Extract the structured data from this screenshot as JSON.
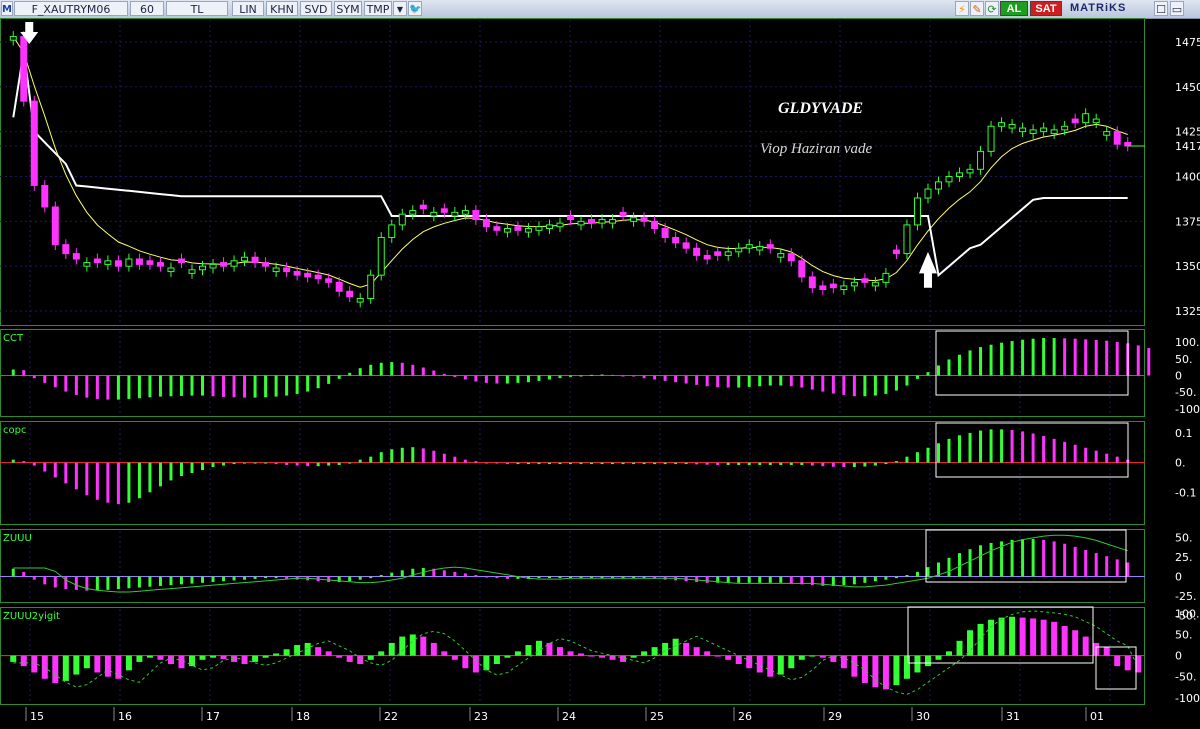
{
  "toolbar": {
    "symbol": "F_XAUTRYM06",
    "period": "60",
    "currency": "TL",
    "buttons": [
      "LIN",
      "KHN",
      "SVD",
      "SYM",
      "TMP"
    ],
    "al_label": "AL",
    "sat_label": "SAT",
    "brand": "MATRiKS",
    "icons": [
      "m-logo-icon",
      "indicator-icon",
      "dropdown-arrow-icon",
      "twitter-bird-icon",
      "lightning-icon",
      "edit-icon",
      "refresh-icon",
      "checkbox-icon",
      "window-icon"
    ]
  },
  "annotations": {
    "title": "GLDYVADE",
    "subtitle": "Viop Haziran vade"
  },
  "panels": [
    {
      "name": "",
      "ticks": [
        "1475.",
        "1450.",
        "1425.",
        "1417.",
        "1400.",
        "1375.",
        "1350.",
        "1325."
      ]
    },
    {
      "name": "CCT",
      "ticks": [
        "100.",
        "50.",
        "0",
        "-50.",
        "-100."
      ]
    },
    {
      "name": "copc",
      "ticks": [
        "0.1",
        "0.",
        "-0.1"
      ]
    },
    {
      "name": "ZUUU",
      "ticks": [
        "50.",
        "25.",
        "0",
        "-25.",
        "-50."
      ]
    },
    {
      "name": "ZUUU2yigit",
      "ticks": [
        "100.",
        "50.",
        "0",
        "-50.",
        "-100."
      ]
    }
  ],
  "time_axis": {
    "labels": [
      "15",
      "16",
      "17",
      "18",
      "22",
      "23",
      "24",
      "25",
      "26",
      "29",
      "30",
      "31",
      "01"
    ]
  },
  "chart_data": {
    "type": "candlestick",
    "ylim": [
      1320,
      1485
    ],
    "last_price": 1417,
    "closes": [
      1478,
      1442,
      1395,
      1383,
      1362,
      1357,
      1354,
      1352,
      1352,
      1353,
      1350,
      1354,
      1351,
      1351,
      1350,
      1349,
      1352,
      1348,
      1350,
      1351,
      1350,
      1353,
      1355,
      1352,
      1350,
      1349,
      1347,
      1345,
      1344,
      1343,
      1341,
      1336,
      1333,
      1332,
      1345,
      1366,
      1373,
      1379,
      1381,
      1382,
      1380,
      1380,
      1380,
      1381,
      1376,
      1372,
      1370,
      1371,
      1370,
      1371,
      1372,
      1373,
      1374,
      1376,
      1375,
      1374,
      1376,
      1376,
      1378,
      1377,
      1375,
      1371,
      1366,
      1363,
      1360,
      1356,
      1354,
      1356,
      1358,
      1360,
      1362,
      1361,
      1360,
      1357,
      1353,
      1344,
      1338,
      1337,
      1338,
      1339,
      1341,
      1341,
      1341,
      1346,
      1357,
      1373,
      1388,
      1393,
      1397,
      1400,
      1402,
      1404,
      1414,
      1428,
      1430,
      1429,
      1427,
      1426,
      1427,
      1426,
      1428,
      1430,
      1435,
      1432,
      1425,
      1418,
      1417
    ],
    "directions": "UDDDDDDUDUDUDDDUDUUUDUUDDUDDDDDDDUUUUUUDUDUUDDDUDUUUUDUDUUDUDDDDDDDDUUUUDUDDDDDUUDUUDUUUUUUUUUUUUUUUUDUUUDDD",
    "buy_arrow_index": 87,
    "sell_arrow_index": 0,
    "cct": {
      "ylim": [
        -115,
        130
      ],
      "values": [
        18,
        16,
        -8,
        -22,
        -35,
        -48,
        -58,
        -66,
        -70,
        -72,
        -72,
        -70,
        -68,
        -65,
        -63,
        -62,
        -61,
        -60,
        -60,
        -62,
        -64,
        -65,
        -66,
        -66,
        -65,
        -63,
        -60,
        -55,
        -48,
        -38,
        -25,
        -10,
        8,
        22,
        32,
        38,
        40,
        38,
        32,
        24,
        15,
        5,
        -5,
        -12,
        -18,
        -22,
        -24,
        -24,
        -22,
        -20,
        -16,
        -12,
        -8,
        -4,
        0,
        2,
        3,
        2,
        0,
        -3,
        -8,
        -12,
        -16,
        -20,
        -24,
        -28,
        -32,
        -35,
        -36,
        -36,
        -34,
        -32,
        -30,
        -30,
        -32,
        -36,
        -42,
        -48,
        -54,
        -58,
        -62,
        -62,
        -60,
        -55,
        -45,
        -30,
        -10,
        10,
        30,
        48,
        62,
        75,
        85,
        92,
        98,
        103,
        107,
        110,
        112,
        112,
        111,
        110,
        108,
        106,
        104,
        100,
        96,
        90,
        82
      ]
    },
    "copc": {
      "ylim": [
        -0.2,
        0.13
      ],
      "values": [
        0.01,
        0.005,
        -0.01,
        -0.03,
        -0.05,
        -0.07,
        -0.09,
        -0.11,
        -0.125,
        -0.135,
        -0.14,
        -0.135,
        -0.12,
        -0.1,
        -0.08,
        -0.06,
        -0.045,
        -0.035,
        -0.025,
        -0.015,
        -0.01,
        -0.005,
        0,
        0,
        0,
        -0.005,
        -0.008,
        -0.01,
        -0.012,
        -0.012,
        -0.01,
        -0.008,
        0,
        0.01,
        0.02,
        0.035,
        0.045,
        0.05,
        0.052,
        0.048,
        0.04,
        0.03,
        0.02,
        0.01,
        0.005,
        0,
        -0.003,
        -0.005,
        -0.005,
        -0.005,
        -0.005,
        -0.005,
        -0.005,
        -0.005,
        -0.005,
        -0.005,
        -0.005,
        -0.005,
        -0.005,
        -0.005,
        -0.005,
        -0.005,
        -0.005,
        -0.005,
        -0.005,
        -0.006,
        -0.007,
        -0.008,
        -0.008,
        -0.008,
        -0.008,
        -0.008,
        -0.008,
        -0.008,
        -0.008,
        -0.008,
        -0.01,
        -0.012,
        -0.014,
        -0.015,
        -0.015,
        -0.013,
        -0.01,
        -0.005,
        0.005,
        0.02,
        0.035,
        0.05,
        0.065,
        0.08,
        0.092,
        0.1,
        0.108,
        0.112,
        0.112,
        0.11,
        0.105,
        0.098,
        0.09,
        0.08,
        0.07,
        0.06,
        0.05,
        0.04,
        0.03,
        0.02,
        0.01
      ]
    },
    "zuuu": {
      "ylim": [
        -30,
        57
      ],
      "values": [
        10,
        6,
        -4,
        -10,
        -14,
        -16,
        -17,
        -18,
        -18,
        -17,
        -16,
        -15,
        -14,
        -13,
        -12,
        -11,
        -10,
        -9,
        -8,
        -7,
        -6,
        -5,
        -4,
        -3,
        -2,
        -2,
        -3,
        -4,
        -5,
        -6,
        -7,
        -7,
        -6,
        -4,
        -2,
        2,
        5,
        8,
        10,
        11,
        10,
        8,
        6,
        4,
        2,
        0,
        -2,
        -3,
        -3,
        -3,
        -2,
        -2,
        -2,
        -2,
        -2,
        -2,
        -2,
        -2,
        -2,
        -2,
        -2,
        -3,
        -4,
        -5,
        -6,
        -7,
        -8,
        -8,
        -8,
        -8,
        -8,
        -8,
        -8,
        -8,
        -9,
        -10,
        -11,
        -12,
        -12,
        -11,
        -10,
        -8,
        -6,
        -4,
        -2,
        2,
        6,
        12,
        18,
        24,
        30,
        35,
        40,
        43,
        45,
        47,
        48,
        48,
        47,
        45,
        42,
        38,
        34,
        30,
        26,
        22,
        18
      ]
    },
    "zuuu2": {
      "ylim": [
        -110,
        108
      ],
      "values": [
        -15,
        -25,
        -40,
        -55,
        -65,
        -60,
        -45,
        -30,
        -40,
        -50,
        -55,
        -35,
        -15,
        -5,
        -10,
        -20,
        -30,
        -25,
        -10,
        -5,
        -8,
        -15,
        -20,
        -15,
        -5,
        5,
        15,
        25,
        30,
        20,
        10,
        -5,
        -15,
        -20,
        -10,
        10,
        30,
        45,
        50,
        45,
        30,
        10,
        -10,
        -30,
        -40,
        -35,
        -20,
        -5,
        10,
        25,
        35,
        30,
        20,
        10,
        5,
        0,
        -5,
        -10,
        -15,
        -5,
        10,
        20,
        30,
        40,
        30,
        20,
        10,
        0,
        -10,
        -20,
        -30,
        -40,
        -50,
        -45,
        -30,
        -10,
        0,
        -5,
        -15,
        -30,
        -50,
        -65,
        -75,
        -80,
        -70,
        -55,
        -40,
        -25,
        -10,
        10,
        35,
        60,
        75,
        85,
        90,
        92,
        90,
        88,
        85,
        80,
        70,
        60,
        45,
        30,
        20,
        -25,
        -35,
        -40
      ]
    }
  },
  "colors": {
    "up": "#33ff33",
    "down": "#ff33ff",
    "ma": "#ffff66",
    "band": "#ffffff",
    "grid": "#1a1a60",
    "zero_line": "#ff3030",
    "axis_text": "#ffffff"
  }
}
